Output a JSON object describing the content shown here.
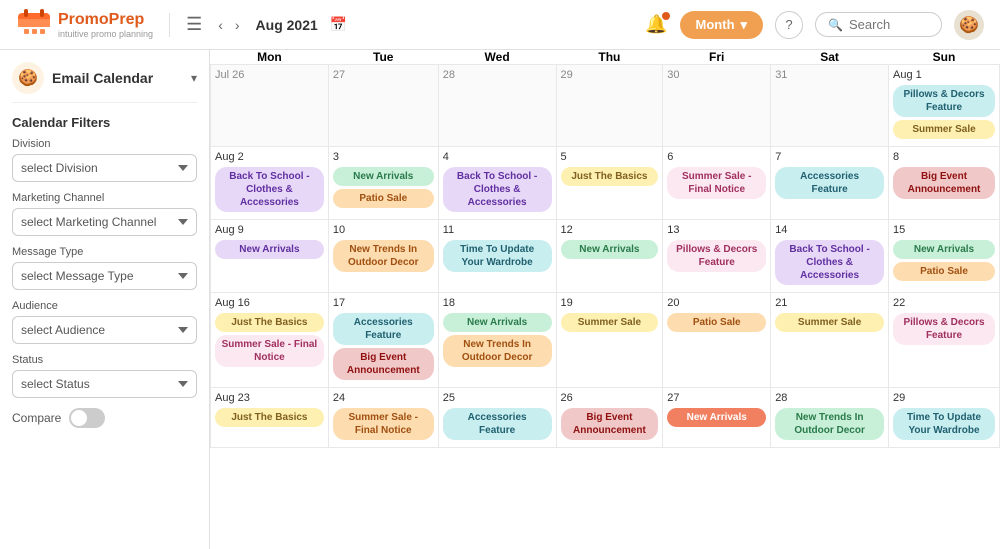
{
  "header": {
    "logo_name": "PromoPrep",
    "logo_sub": "intuitive promo planning",
    "month_label": "Aug 2021",
    "month_btn": "Month",
    "search_placeholder": "Search",
    "help_label": "?",
    "calendar_label": "Email Calendar"
  },
  "sidebar": {
    "title": "Email Calendar",
    "filters_title": "Calendar Filters",
    "division_label": "Division",
    "division_placeholder": "select Division",
    "channel_label": "Marketing Channel",
    "channel_placeholder": "select Marketing Channel",
    "message_label": "Message Type",
    "message_placeholder": "select Message Type",
    "audience_label": "Audience",
    "audience_placeholder": "select Audience",
    "status_label": "Status",
    "status_placeholder": "select Status",
    "compare_label": "Compare"
  },
  "calendar": {
    "day_headers": [
      "Mon",
      "Tue",
      "Wed",
      "Thu",
      "Fri",
      "Sat",
      "Sun"
    ],
    "weeks": [
      {
        "days": [
          {
            "date": "Jul 26",
            "other": true,
            "events": []
          },
          {
            "date": "27",
            "other": true,
            "events": []
          },
          {
            "date": "28",
            "other": true,
            "events": []
          },
          {
            "date": "29",
            "other": true,
            "events": []
          },
          {
            "date": "30",
            "other": true,
            "events": []
          },
          {
            "date": "31",
            "other": true,
            "events": []
          },
          {
            "date": "Aug 1",
            "other": false,
            "events": [
              {
                "label": "Pillows & Decors Feature",
                "color": "teal"
              },
              {
                "label": "Summer Sale",
                "color": "yellow"
              }
            ]
          }
        ]
      },
      {
        "days": [
          {
            "date": "Aug 2",
            "other": false,
            "events": [
              {
                "label": "Back To School - Clothes & Accessories",
                "color": "purple"
              }
            ]
          },
          {
            "date": "3",
            "other": false,
            "events": [
              {
                "label": "New Arrivals",
                "color": "green"
              },
              {
                "label": "Patio Sale",
                "color": "orange"
              }
            ]
          },
          {
            "date": "4",
            "other": false,
            "events": [
              {
                "label": "Back To School - Clothes & Accessories",
                "color": "purple"
              }
            ]
          },
          {
            "date": "5",
            "other": false,
            "events": [
              {
                "label": "Just The Basics",
                "color": "yellow"
              }
            ]
          },
          {
            "date": "6",
            "other": false,
            "events": [
              {
                "label": "Summer Sale - Final Notice",
                "color": "pink"
              }
            ]
          },
          {
            "date": "7",
            "other": false,
            "events": [
              {
                "label": "Accessories Feature",
                "color": "teal"
              }
            ]
          },
          {
            "date": "8",
            "other": false,
            "events": [
              {
                "label": "Big Event Announcement",
                "color": "red"
              }
            ]
          }
        ]
      },
      {
        "days": [
          {
            "date": "Aug 9",
            "other": false,
            "events": [
              {
                "label": "New Arrivals",
                "color": "purple"
              }
            ]
          },
          {
            "date": "10",
            "other": false,
            "events": [
              {
                "label": "New Trends In Outdoor Decor",
                "color": "orange"
              }
            ]
          },
          {
            "date": "11",
            "other": false,
            "events": [
              {
                "label": "Time To Update Your Wardrobe",
                "color": "teal"
              }
            ]
          },
          {
            "date": "12",
            "other": false,
            "events": [
              {
                "label": "New Arrivals",
                "color": "green"
              }
            ]
          },
          {
            "date": "13",
            "other": false,
            "events": [
              {
                "label": "Pillows & Decors Feature",
                "color": "pink"
              }
            ]
          },
          {
            "date": "14",
            "other": false,
            "events": [
              {
                "label": "Back To School - Clothes & Accessories",
                "color": "purple"
              }
            ]
          },
          {
            "date": "15",
            "other": false,
            "events": [
              {
                "label": "New Arrivals",
                "color": "green"
              },
              {
                "label": "Patio Sale",
                "color": "orange"
              }
            ]
          }
        ]
      },
      {
        "days": [
          {
            "date": "Aug 16",
            "other": false,
            "events": [
              {
                "label": "Just The Basics",
                "color": "yellow"
              },
              {
                "label": "Summer Sale - Final Notice",
                "color": "pink"
              }
            ]
          },
          {
            "date": "17",
            "other": false,
            "events": [
              {
                "label": "Accessories Feature",
                "color": "teal"
              },
              {
                "label": "Big Event Announcement",
                "color": "red"
              }
            ]
          },
          {
            "date": "18",
            "other": false,
            "events": [
              {
                "label": "New Arrivals",
                "color": "green"
              },
              {
                "label": "New Trends In Outdoor Decor",
                "color": "orange"
              }
            ]
          },
          {
            "date": "19",
            "other": false,
            "events": [
              {
                "label": "Summer Sale",
                "color": "yellow"
              }
            ]
          },
          {
            "date": "20",
            "other": false,
            "events": [
              {
                "label": "Patio Sale",
                "color": "orange"
              }
            ]
          },
          {
            "date": "21",
            "other": false,
            "events": [
              {
                "label": "Summer Sale",
                "color": "yellow"
              }
            ]
          },
          {
            "date": "22",
            "other": false,
            "events": [
              {
                "label": "Pillows & Decors Feature",
                "color": "pink"
              }
            ]
          }
        ]
      },
      {
        "days": [
          {
            "date": "Aug 23",
            "other": false,
            "events": [
              {
                "label": "Just The Basics",
                "color": "yellow"
              }
            ]
          },
          {
            "date": "24",
            "other": false,
            "events": [
              {
                "label": "Summer Sale - Final Notice",
                "color": "orange"
              }
            ]
          },
          {
            "date": "25",
            "other": false,
            "events": [
              {
                "label": "Accessories Feature",
                "color": "teal"
              }
            ]
          },
          {
            "date": "26",
            "other": false,
            "events": [
              {
                "label": "Big Event Announcement",
                "color": "red"
              }
            ]
          },
          {
            "date": "27",
            "other": false,
            "events": [
              {
                "label": "New Arrivals",
                "color": "coral"
              }
            ]
          },
          {
            "date": "28",
            "other": false,
            "events": [
              {
                "label": "New Trends In Outdoor Decor",
                "color": "green"
              }
            ]
          },
          {
            "date": "29",
            "other": false,
            "events": [
              {
                "label": "Time To Update Your Wardrobe",
                "color": "teal"
              }
            ]
          }
        ]
      }
    ]
  }
}
